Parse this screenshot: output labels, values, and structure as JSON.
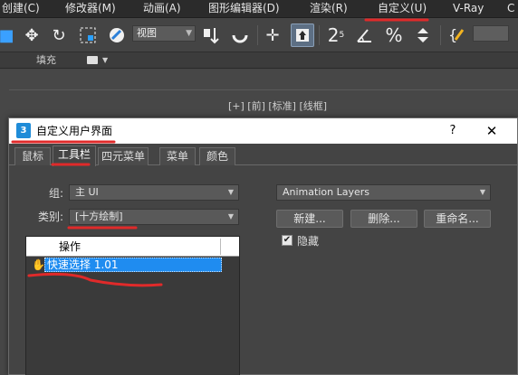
{
  "menubar": {
    "items": [
      "创建(C)",
      "修改器(M)",
      "动画(A)",
      "图形编辑器(D)",
      "渲染(R)",
      "自定义(U)",
      "V-Ray",
      "C"
    ]
  },
  "toolbar": {
    "view_select": "视图",
    "icons": [
      "move-icon",
      "rotate-icon",
      "scale-icon",
      "paint-select-icon",
      "view-dropdown",
      "pivot-icon",
      "snap-toggle-icon",
      "crosshair-icon",
      "select-highlight-icon",
      "angle-snap-icon",
      "percent-snap-icon",
      "spinner-snap-icon",
      "edit-named-selection-icon"
    ]
  },
  "ribbon": {
    "label": "填充"
  },
  "viewport": {
    "label": "[+] [前] [标准] [线框]"
  },
  "dialog": {
    "title": "自定义用户界面",
    "help": "?",
    "close": "✕",
    "tabs": [
      "鼠标",
      "工具栏",
      "四元菜单",
      "菜单",
      "颜色"
    ],
    "active_tab": 1,
    "group_label": "组:",
    "group_value": "主 UI",
    "category_label": "类别:",
    "category_value": "[十方绘制]",
    "toolbar_combo": "Animation Layers",
    "buttons": {
      "new": "新建...",
      "delete": "删除...",
      "rename": "重命名..."
    },
    "hide_checkbox_label": "隐藏",
    "hide_checked": true,
    "list": {
      "header": "操作",
      "rows": [
        {
          "label": "快速选择 1.01",
          "selected": true
        }
      ]
    }
  },
  "colors": {
    "annotation_red": "#e02a2a",
    "selection_blue": "#1f8cf0",
    "panel_bg": "#444444"
  }
}
